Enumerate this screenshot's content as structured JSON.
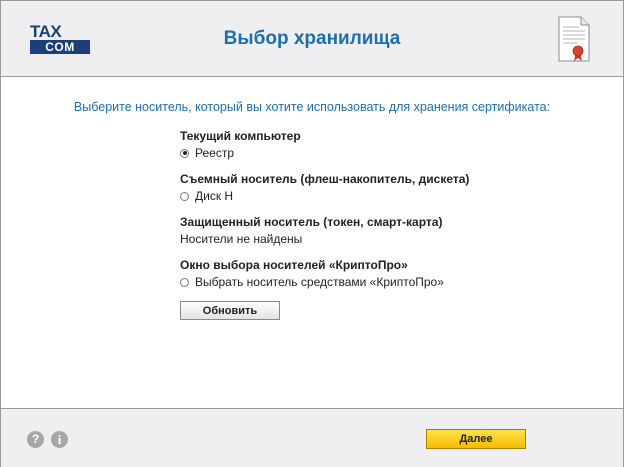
{
  "header": {
    "logo_top": "TAX",
    "logo_bottom": "COM",
    "title": "Выбор хранилища"
  },
  "content": {
    "prompt": "Выберите носитель, который вы хотите использовать для хранения сертификата:",
    "sections": [
      {
        "title": "Текущий компьютер",
        "option": "Реестр",
        "selected": true
      },
      {
        "title": "Съемный носитель (флеш-накопитель, дискета)",
        "option": "Диск H",
        "selected": false
      },
      {
        "title": "Защищенный носитель (токен, смарт-карта)",
        "status": "Носители не найдены"
      },
      {
        "title": "Окно выбора носителей «КриптоПро»",
        "option": "Выбрать носитель средствами «КриптоПро»",
        "selected": false
      }
    ],
    "refresh_label": "Обновить"
  },
  "footer": {
    "help_glyph": "?",
    "info_glyph": "i",
    "next_label": "Далее"
  },
  "colors": {
    "accent": "#1c6fb1",
    "logo": "#1c3f7a",
    "next_button": "#f5c800"
  },
  "icons": [
    "certificate-icon",
    "help-icon",
    "info-icon"
  ]
}
